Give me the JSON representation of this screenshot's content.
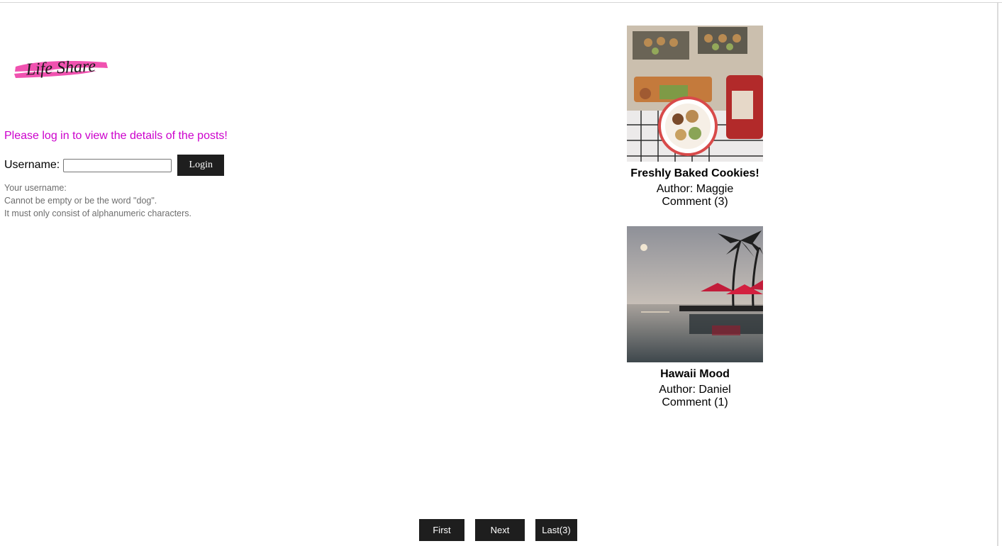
{
  "logo": {
    "text": "Life Share",
    "brush_color": "#f052b0"
  },
  "login": {
    "prompt": "Please log in to view the details of the posts!",
    "prompt_color": "#cc00cc",
    "username_label": "Username:",
    "username_value": "",
    "button_label": "Login",
    "hint_lines": [
      "Your username:",
      "Cannot be empty or be the word \"dog\".",
      "It must only consist of alphanumeric characters."
    ]
  },
  "posts": [
    {
      "title": "Freshly Baked Cookies!",
      "author": "Author: Maggie",
      "comments": "Comment (3)",
      "image": "cookies-photo"
    },
    {
      "title": "Hawaii Mood",
      "author": "Author: Daniel",
      "comments": "Comment (1)",
      "image": "hawaii-pool-sunset-photo"
    }
  ],
  "pagination": {
    "first_label": "First",
    "next_label": "Next",
    "last_label": "Last(3)"
  }
}
